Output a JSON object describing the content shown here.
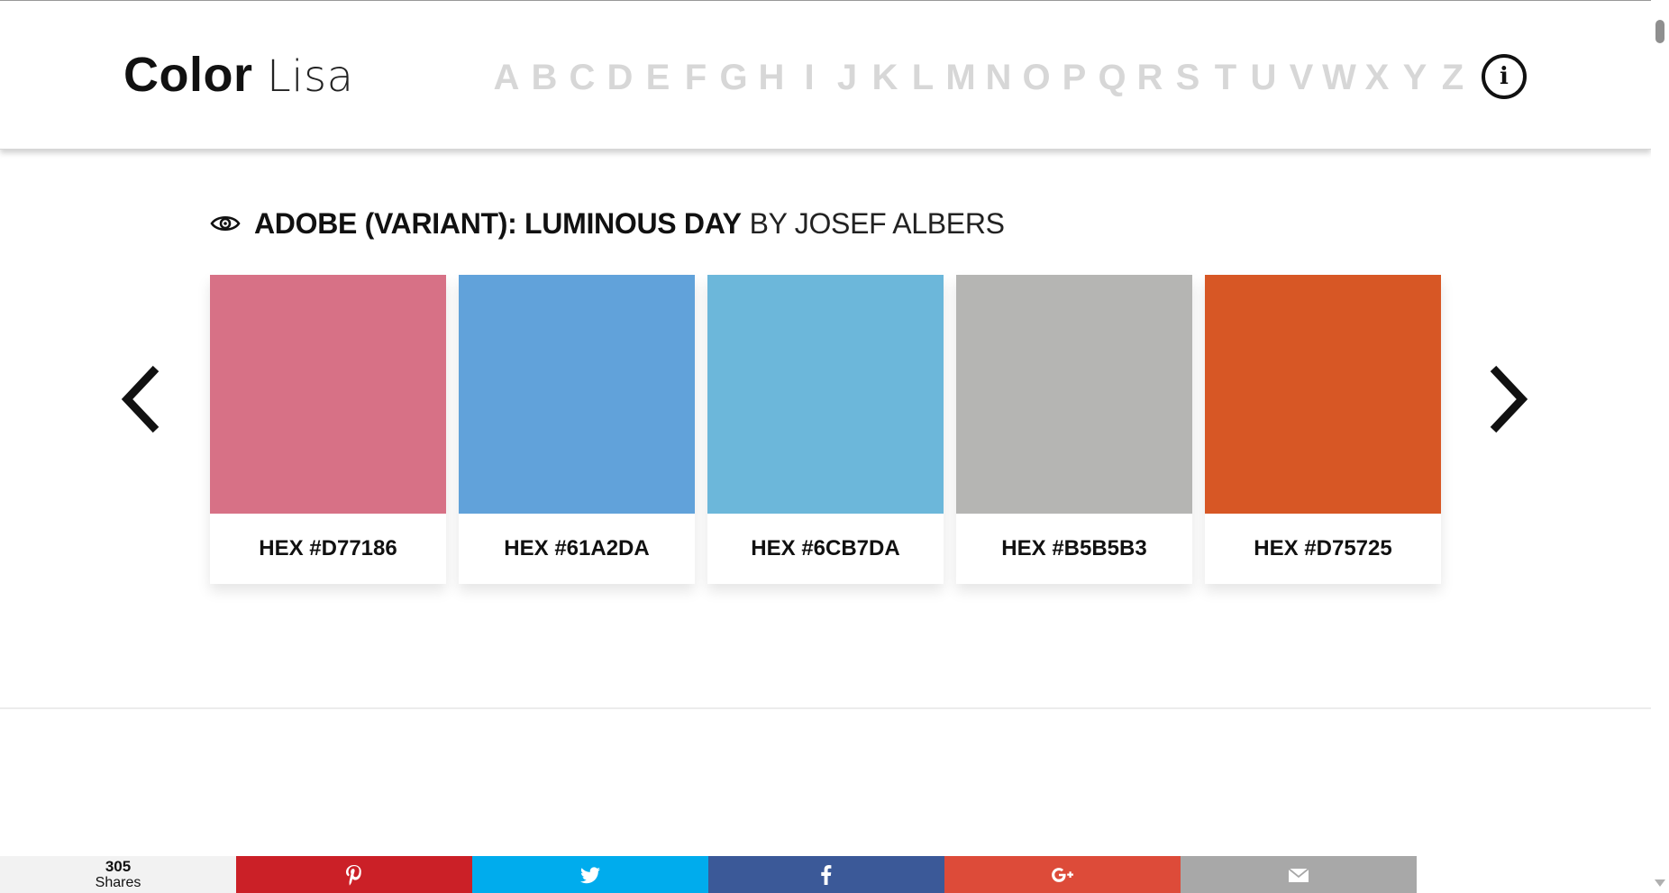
{
  "header": {
    "logo_bold": "Color",
    "logo_light": "Lisa",
    "alphabet": [
      "A",
      "B",
      "C",
      "D",
      "E",
      "F",
      "G",
      "H",
      "I",
      "J",
      "K",
      "L",
      "M",
      "N",
      "O",
      "P",
      "Q",
      "R",
      "S",
      "T",
      "U",
      "V",
      "W",
      "X",
      "Y",
      "Z"
    ],
    "info_label": "i"
  },
  "reading_progress": 0.45,
  "palette": {
    "title": "ADOBE (VARIANT): LUMINOUS DAY",
    "artist": "BY JOSEF ALBERS",
    "swatches": [
      {
        "hex": "#D77186",
        "label": "HEX #D77186"
      },
      {
        "hex": "#61A2DA",
        "label": "HEX #61A2DA"
      },
      {
        "hex": "#6CB7DA",
        "label": "HEX #6CB7DA"
      },
      {
        "hex": "#B5B5B3",
        "label": "HEX #B5B5B3"
      },
      {
        "hex": "#D75725",
        "label": "HEX #D75725"
      }
    ]
  },
  "share": {
    "count": "305",
    "count_label": "Shares",
    "buttons": [
      {
        "network": "pinterest",
        "icon": "pinterest-icon",
        "color": "#CB2027"
      },
      {
        "network": "twitter",
        "icon": "twitter-icon",
        "color": "#00ACED"
      },
      {
        "network": "facebook",
        "icon": "facebook-icon",
        "color": "#3B5998"
      },
      {
        "network": "google-plus",
        "icon": "google-plus-icon",
        "color": "#DD4B39"
      },
      {
        "network": "email",
        "icon": "email-icon",
        "color": "#A8A8A8"
      }
    ]
  }
}
